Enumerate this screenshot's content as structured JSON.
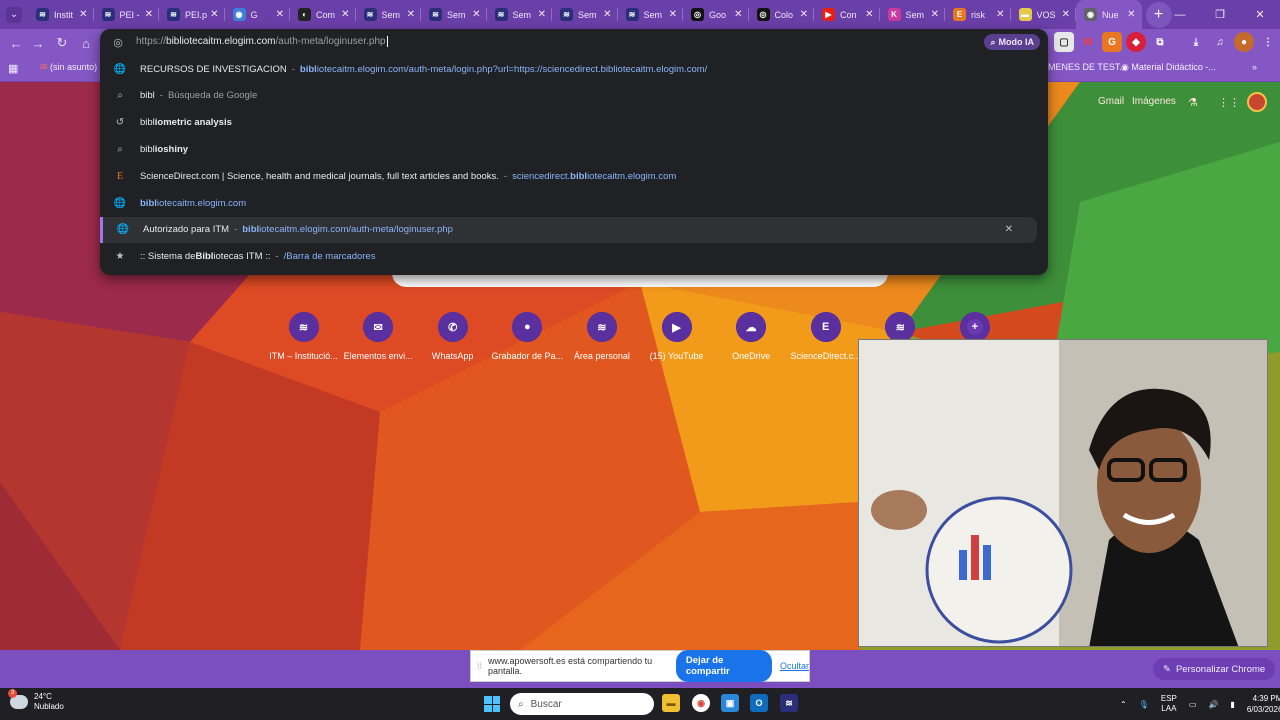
{
  "tabs": [
    {
      "label": "Instit",
      "fav_color": "#2b2f7a",
      "fav_glyph": "≋"
    },
    {
      "label": "PEI -",
      "fav_color": "#2b2f7a",
      "fav_glyph": "≋"
    },
    {
      "label": "PEI.p",
      "fav_color": "#2b2f7a",
      "fav_glyph": "≋"
    },
    {
      "label": "G",
      "fav_color": "#3f7fd8",
      "fav_glyph": "◉"
    },
    {
      "label": "Com",
      "fav_color": "#222222",
      "fav_glyph": "◐"
    },
    {
      "label": "Sem",
      "fav_color": "#2b2f7a",
      "fav_glyph": "≋"
    },
    {
      "label": "Sem",
      "fav_color": "#2b2f7a",
      "fav_glyph": "≋"
    },
    {
      "label": "Sem",
      "fav_color": "#2b2f7a",
      "fav_glyph": "≋"
    },
    {
      "label": "Sem",
      "fav_color": "#2b2f7a",
      "fav_glyph": "≋"
    },
    {
      "label": "Sem",
      "fav_color": "#2b2f7a",
      "fav_glyph": "≋"
    },
    {
      "label": "Goo",
      "fav_color": "#111111",
      "fav_glyph": "◎"
    },
    {
      "label": "Colo",
      "fav_color": "#111111",
      "fav_glyph": "◎"
    },
    {
      "label": "Con",
      "fav_color": "#e62117",
      "fav_glyph": "▶"
    },
    {
      "label": "Sem",
      "fav_color": "#c93a9c",
      "fav_glyph": "K"
    },
    {
      "label": "risk",
      "fav_color": "#e87722",
      "fav_glyph": "E"
    },
    {
      "label": "VOS",
      "fav_color": "#e7c94a",
      "fav_glyph": "▬"
    },
    {
      "label": "Nue",
      "fav_color": "#5f6368",
      "fav_glyph": "◉",
      "active": true
    }
  ],
  "omnibox": {
    "url_prefix": "https://",
    "url_host": "bibliotecaitm.elogim.com",
    "url_path": "/auth-meta/loginuser.php",
    "ai_mode_label": "Modo IA"
  },
  "suggestions": [
    {
      "icon": "globe-icon",
      "glyph": "🌐",
      "title": "RECURSOS DE INVESTIGACION",
      "sep": "-",
      "link_bold": "bibl",
      "link_rest": "iotecaitm.elogim.com/auth-meta/login.php?url=https://sciencedirect.bibliotecaitm.elogim.com/"
    },
    {
      "icon": "search-icon",
      "glyph": "⌕",
      "title_bold": "",
      "title_plain": "bibl",
      "sep": "-",
      "grey": "Búsqueda de Google"
    },
    {
      "icon": "history-icon",
      "glyph": "↺",
      "title_plain": "bibl",
      "title_bold": "iometric analysis"
    },
    {
      "icon": "search-icon",
      "glyph": "⌕",
      "title_plain": "bibl",
      "title_bold": "ioshiny"
    },
    {
      "icon": "elsevier-icon",
      "glyph": "E",
      "title": "ScienceDirect.com | Science, health and medical journals, full text articles and books.",
      "sep": "-",
      "link_pre": "sciencedirect.",
      "link_bold": "bibl",
      "link_rest": "iotecaitm.elogim.com"
    },
    {
      "icon": "globe-icon",
      "glyph": "🌐",
      "link_bold": "bibl",
      "link_rest": "iotecaitm.elogim.com"
    },
    {
      "icon": "globe-icon",
      "glyph": "🌐",
      "title": "Autorizado para ITM",
      "sep": "-",
      "link_bold": "bibl",
      "link_rest": "iotecaitm.elogim.com/auth-meta/loginuser.php",
      "selected": true
    },
    {
      "icon": "star-icon",
      "glyph": "★",
      "title_pre": ":: Sistema de ",
      "title_bold": "Bibl",
      "title_post": "iotecas ITM ::",
      "sep": "-",
      "link_rest": "/Barra de marcadores"
    }
  ],
  "bookmarks": {
    "left": "(sin asunto) -",
    "right1": "MENES DE TEST...",
    "right2": "Material Didáctico -..."
  },
  "google": {
    "gmail": "Gmail",
    "images": "Imágenes"
  },
  "shortcuts": [
    {
      "label": "ITM – Institució...",
      "glyph": "≋",
      "color": "#2b2f7a"
    },
    {
      "label": "Elementos envi...",
      "glyph": "✉",
      "color": "#3366cc"
    },
    {
      "label": "WhatsApp",
      "glyph": "✆",
      "color": "#25a244"
    },
    {
      "label": "Grabador de Pa...",
      "glyph": "●",
      "color": "#1d9bb8"
    },
    {
      "label": "Área personal",
      "glyph": "≋",
      "color": "#2b2f7a"
    },
    {
      "label": "(15) YouTube",
      "glyph": "▶",
      "color": "#e62117"
    },
    {
      "label": "OneDrive",
      "glyph": "☁",
      "color": "#0f78d4"
    },
    {
      "label": "ScienceDirect.c...",
      "glyph": "E",
      "color": "#e87722"
    },
    {
      "label": "",
      "glyph": "≋",
      "color": "#2b2f7a"
    },
    {
      "label": "",
      "glyph": "+",
      "color": "#6a3bb0"
    }
  ],
  "share_bar": {
    "message": "www.apowersoft.es está compartiendo tu pantalla.",
    "stop_label": "Dejar de compartir",
    "hide_label": "Ocultar"
  },
  "customize_label": "Personalizar Chrome",
  "taskbar": {
    "temperature": "24°C",
    "weather": "Nublado",
    "weather_badge": "3",
    "search_placeholder": "Buscar",
    "lang_top": "ESP",
    "lang_bottom": "LAA",
    "time": "4:39 PM",
    "date": "6/03/2026"
  },
  "colors": {
    "accent": "#8457c4",
    "dropdown_bg": "#202124",
    "link": "#8ab4f8"
  }
}
